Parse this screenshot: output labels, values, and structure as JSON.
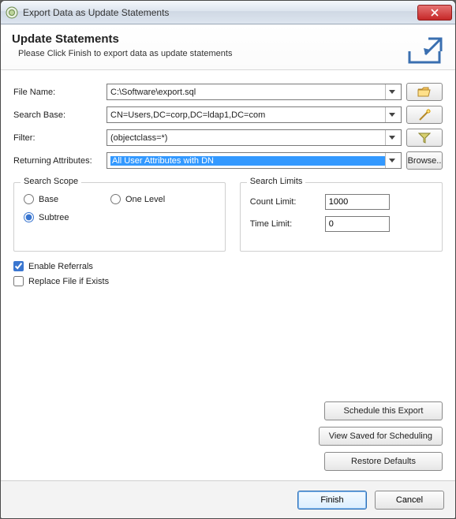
{
  "window": {
    "title": "Export Data as Update Statements"
  },
  "header": {
    "title": "Update Statements",
    "subtitle": "Please Click Finish to export data as update statements"
  },
  "form": {
    "fileName": {
      "label": "File Name:",
      "value": "C:\\Software\\export.sql"
    },
    "searchBase": {
      "label": "Search Base:",
      "value": "CN=Users,DC=corp,DC=ldap1,DC=com"
    },
    "filter": {
      "label": "Filter:",
      "value": "(objectclass=*)"
    },
    "retAttrs": {
      "label": "Returning Attributes:",
      "value": "All User Attributes with DN",
      "browse": "Browse.."
    }
  },
  "scope": {
    "legend": "Search Scope",
    "base": "Base",
    "oneLevel": "One Level",
    "subtree": "Subtree",
    "selected": "subtree"
  },
  "limits": {
    "legend": "Search Limits",
    "count": {
      "label": "Count Limit:",
      "value": "1000"
    },
    "time": {
      "label": "Time Limit:",
      "value": "0"
    }
  },
  "options": {
    "enableReferrals": {
      "label": "Enable Referrals",
      "checked": true
    },
    "replaceFile": {
      "label": "Replace File if Exists",
      "checked": false
    }
  },
  "actions": {
    "schedule": "Schedule this Export",
    "viewSaved": "View Saved for Scheduling",
    "restore": "Restore Defaults"
  },
  "footer": {
    "finish": "Finish",
    "cancel": "Cancel"
  }
}
